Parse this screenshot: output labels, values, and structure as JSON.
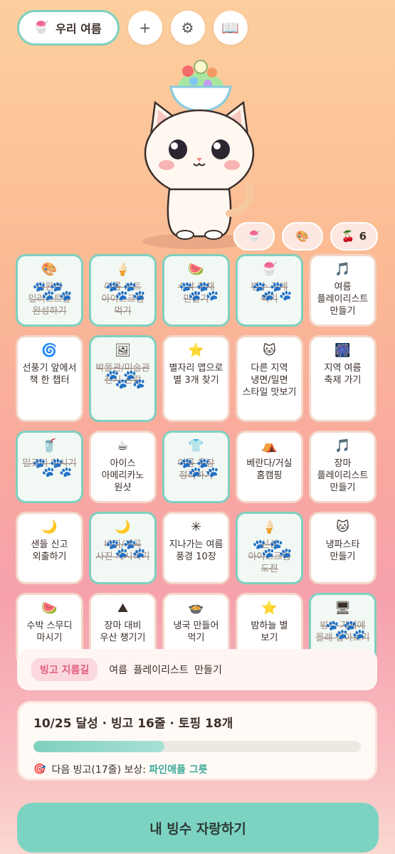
{
  "header": {
    "title": "우리 여름",
    "buttons": [
      {
        "name": "add",
        "glyph": "+"
      },
      {
        "name": "settings",
        "glyph": "⚙"
      },
      {
        "name": "book",
        "glyph": "📖"
      }
    ]
  },
  "toppings": {
    "cherry_count": "6"
  },
  "bingo": {
    "cells": [
      {
        "label": "미완성 일러스트를 완성하기",
        "icon": "🎨",
        "done": true
      },
      {
        "label": "여름 노트 아이스크림 먹기",
        "icon": "🍦",
        "done": true
      },
      {
        "label": "수박 화채 만들기",
        "icon": "🍉",
        "done": true
      },
      {
        "label": "빙수 가게 먹기",
        "icon": "🍧",
        "done": true
      },
      {
        "label": "여름 플레이리스트 만들기",
        "icon": "🎵",
        "done": false
      },
      {
        "label": "선풍기 앞에서 책 한 챕터",
        "icon": "🌀",
        "done": false
      },
      {
        "label": "박물관/미술관 전시 관람",
        "icon": "🖼",
        "done": true
      },
      {
        "label": "별자리 앱으로 별 3개 찾기",
        "icon": "⭐",
        "done": false
      },
      {
        "label": "다른 지역 냉면/밀면 스타일 맛보기",
        "icon": "🐱",
        "done": false
      },
      {
        "label": "지역 여름 축제 가기",
        "icon": "🎆",
        "done": false
      },
      {
        "label": "밀크티 마시기",
        "icon": "🥤",
        "done": true
      },
      {
        "label": "아이스 아메리카노 원샷",
        "icon": "☕",
        "done": false
      },
      {
        "label": "여름 옷장 정리하기",
        "icon": "👕",
        "done": true
      },
      {
        "label": "베란다/거실 홈캠핑",
        "icon": "⛺",
        "done": false
      },
      {
        "label": "장마 플레이리스트 만들기",
        "icon": "🎵",
        "done": false
      },
      {
        "label": "샌들 신고 외출하기",
        "icon": "🌙",
        "done": false
      },
      {
        "label": "바다/계곡 사진 게시하기",
        "icon": "🌙",
        "done": true
      },
      {
        "label": "지나가는 여름 풍경 10장",
        "icon": "✳",
        "done": false
      },
      {
        "label": "신상 아이스크림 도전",
        "icon": "🍦",
        "done": true
      },
      {
        "label": "냉파스타 만들기",
        "icon": "🐱",
        "done": false
      },
      {
        "label": "수박 스무디 마시기",
        "icon": "🍉",
        "done": false
      },
      {
        "label": "장마 대비 우산 챙기기",
        "icon": "⛰",
        "done": false
      },
      {
        "label": "냉국 만들어 먹기",
        "icon": "🍲",
        "done": false
      },
      {
        "label": "밤하늘 별 보기",
        "icon": "⭐",
        "done": false
      },
      {
        "label": "빙수 가게에 몰래 갈아보기",
        "icon": "🖥",
        "done": true
      }
    ]
  },
  "shortcut": {
    "badge": "빙고 지름길",
    "text": "여름 플레이리스트 만들기"
  },
  "progress": {
    "summary": "10/25 달성 · 빙고 16줄 · 토핑 18개",
    "fraction": 0.4,
    "next_label": "다음 빙고(17줄) 보상: ",
    "next_reward": "파인애플 그릇"
  },
  "share_button": "내 빙수 자랑하기",
  "colors": {
    "accent": "#7fd0bf",
    "reward": "#3aa898"
  }
}
